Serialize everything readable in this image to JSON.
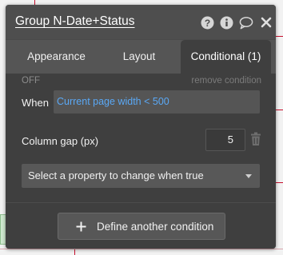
{
  "header": {
    "title": "Group N-Date+Status",
    "icons": [
      "help-icon",
      "info-icon",
      "comment-icon",
      "close-icon"
    ]
  },
  "tabs": [
    {
      "label": "Appearance",
      "active": false
    },
    {
      "label": "Layout",
      "active": false
    },
    {
      "label": "Conditional (1)",
      "active": true
    }
  ],
  "condition": {
    "status": "OFF",
    "remove_label": "remove condition",
    "when_label": "When",
    "when_expression": "Current page width < 500",
    "property_label": "Column gap (px)",
    "property_value": "5",
    "select_placeholder": "Select a property to change when true"
  },
  "footer": {
    "define_label": "Define another condition"
  },
  "colors": {
    "panel_bg": "#4a4a4a",
    "body_bg": "#3f3f3f",
    "expression_text": "#5aa8f5"
  }
}
